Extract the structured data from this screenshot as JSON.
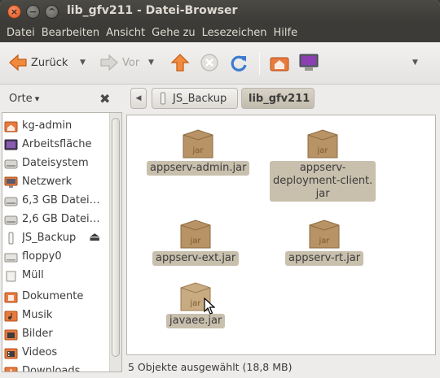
{
  "window": {
    "title": "lib_gfv211 - Datei-Browser",
    "close_glyph": "×",
    "min_glyph": "−",
    "max_glyph": "^"
  },
  "menu": [
    "Datei",
    "Bearbeiten",
    "Ansicht",
    "Gehe zu",
    "Lesezeichen",
    "Hilfe"
  ],
  "toolbar": {
    "back_label": "Zurück",
    "forward_label": "Vor",
    "dropdown_glyph": "▼"
  },
  "sidebar": {
    "header": "Orte",
    "header_arrow": "▾",
    "close_glyph": "✖",
    "items": [
      {
        "label": "kg-admin",
        "icon": "home-folder-icon"
      },
      {
        "label": "Arbeitsfläche",
        "icon": "desktop-icon"
      },
      {
        "label": "Dateisystem",
        "icon": "harddisk-icon"
      },
      {
        "label": "Netzwerk",
        "icon": "network-icon"
      },
      {
        "label": "6,3 GB Datei…",
        "icon": "harddisk-icon"
      },
      {
        "label": "2,6 GB Datei…",
        "icon": "harddisk-icon"
      },
      {
        "label": "JS_Backup",
        "icon": "usb-drive-icon"
      },
      {
        "label": "floppy0",
        "icon": "floppy-icon"
      },
      {
        "label": "Müll",
        "icon": "trash-icon"
      },
      {
        "label": "Dokumente",
        "icon": "documents-folder-icon"
      },
      {
        "label": "Musik",
        "icon": "music-folder-icon"
      },
      {
        "label": "Bilder",
        "icon": "pictures-folder-icon"
      },
      {
        "label": "Videos",
        "icon": "videos-folder-icon"
      },
      {
        "label": "Downloads",
        "icon": "downloads-folder-icon"
      }
    ],
    "eject_glyph": "⏏"
  },
  "pathbar": {
    "left_arrow": "◀",
    "crumbs": [
      "JS_Backup",
      "lib_gfv211"
    ]
  },
  "files": [
    {
      "name": "appserv-admin.jar",
      "lines": [
        "appserv-admin.jar"
      ],
      "icon_text": "jar"
    },
    {
      "name": "appserv-deployment-client.jar",
      "lines": [
        "appserv-",
        "deployment-client.",
        "jar"
      ],
      "icon_text": "jar"
    },
    {
      "name": "appserv-ext.jar",
      "lines": [
        "appserv-ext.jar"
      ],
      "icon_text": "jar"
    },
    {
      "name": "appserv-rt.jar",
      "lines": [
        "appserv-rt.jar"
      ],
      "icon_text": "jar"
    },
    {
      "name": "javaee.jar",
      "lines": [
        "javaee.jar"
      ],
      "icon_text": "jar"
    }
  ],
  "status": {
    "text": "5 Objekte ausgewählt (18,8 MB)"
  },
  "colors": {
    "titlebar": "#3c3b37",
    "selection": "#c8bfad",
    "close_button": "#e05518"
  }
}
